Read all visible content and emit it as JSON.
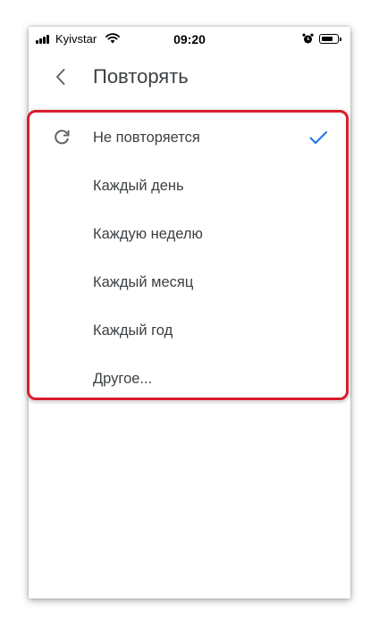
{
  "status_bar": {
    "carrier": "Kyivstar",
    "time": "09:20",
    "signal_icon": "signal-icon",
    "wifi_icon": "wifi-icon",
    "alarm_icon": "alarm-icon",
    "battery_icon": "battery-icon"
  },
  "header": {
    "back_icon": "chevron-left-icon",
    "title": "Повторять"
  },
  "options": [
    {
      "label": "Не повторяется",
      "icon": "repeat-icon",
      "selected": true
    },
    {
      "label": "Каждый день",
      "selected": false
    },
    {
      "label": "Каждую неделю",
      "selected": false
    },
    {
      "label": "Каждый месяц",
      "selected": false
    },
    {
      "label": "Каждый год",
      "selected": false
    },
    {
      "label": "Другое...",
      "selected": false
    }
  ],
  "colors": {
    "accent": "#1a73e8",
    "text": "#3c4043",
    "icon": "#5f6368",
    "highlight": "#d81e2b"
  }
}
